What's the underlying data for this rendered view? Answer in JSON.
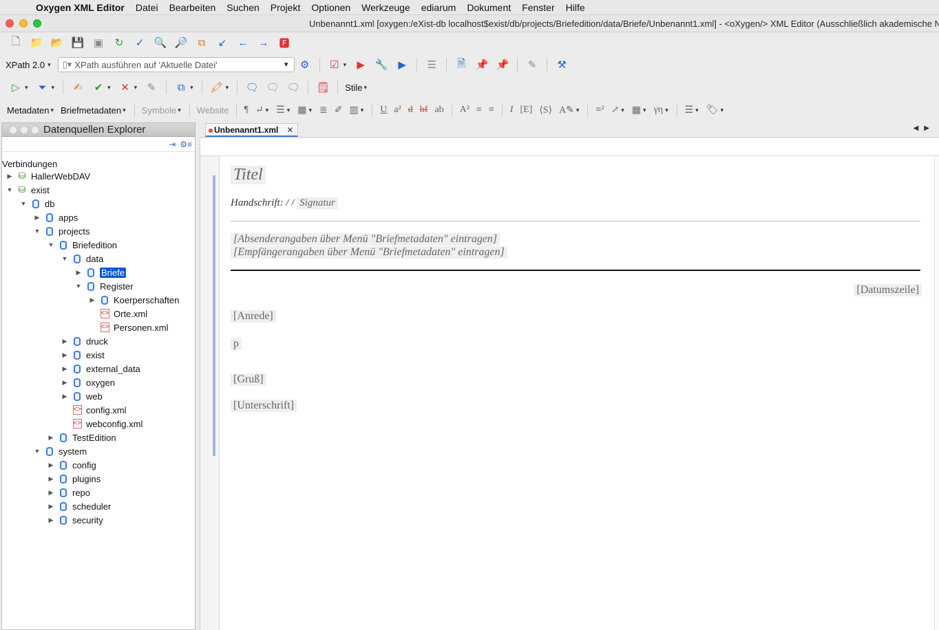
{
  "menubar": {
    "app_name": "Oxygen XML Editor",
    "items": [
      "Datei",
      "Bearbeiten",
      "Suchen",
      "Projekt",
      "Optionen",
      "Werkzeuge",
      "ediarum",
      "Dokument",
      "Fenster",
      "Hilfe"
    ]
  },
  "window": {
    "title": "Unbenannt1.xml [oxygen:/eXist-db localhost$exist/db/projects/Briefedition/data/Briefe/Unbenannt1.xml] - <oXygen/> XML Editor (Ausschließlich akademische Nutzung)"
  },
  "xpath": {
    "version_label": "XPath 2.0",
    "combo_text": "XPath ausführen auf  'Aktuelle Datei'"
  },
  "toolbar3": {
    "styles_label": "Stile"
  },
  "toolbar4": {
    "metadaten": "Metadaten",
    "briefmetadaten": "Briefmetadaten",
    "symbole": "Symbole",
    "website": "Website"
  },
  "explorer": {
    "title": "Datenquellen Explorer",
    "connections_label": "Verbindungen",
    "nodes": [
      {
        "label": "HallerWebDAV",
        "icon": "server-icon",
        "expanded": false
      },
      {
        "label": "exist",
        "icon": "server-icon",
        "expanded": true
      },
      {
        "label": "db",
        "icon": "database-icon",
        "expanded": true
      },
      {
        "label": "apps",
        "icon": "collection-icon",
        "expanded": false
      },
      {
        "label": "projects",
        "icon": "collection-icon",
        "expanded": true
      },
      {
        "label": "Briefedition",
        "icon": "collection-icon",
        "expanded": true
      },
      {
        "label": "data",
        "icon": "collection-icon",
        "expanded": true
      },
      {
        "label": "Briefe",
        "icon": "collection-icon",
        "expanded": false,
        "selected": true
      },
      {
        "label": "Register",
        "icon": "collection-icon",
        "expanded": true
      },
      {
        "label": "Koerperschaften",
        "icon": "collection-icon",
        "expanded": false
      },
      {
        "label": "Orte.xml",
        "icon": "xml-file-icon"
      },
      {
        "label": "Personen.xml",
        "icon": "xml-file-icon"
      },
      {
        "label": "druck",
        "icon": "collection-icon",
        "expanded": false
      },
      {
        "label": "exist",
        "icon": "collection-icon",
        "expanded": false
      },
      {
        "label": "external_data",
        "icon": "collection-icon",
        "expanded": false
      },
      {
        "label": "oxygen",
        "icon": "collection-icon",
        "expanded": false
      },
      {
        "label": "web",
        "icon": "collection-icon",
        "expanded": false
      },
      {
        "label": "config.xml",
        "icon": "xml-file-icon"
      },
      {
        "label": "webconfig.xml",
        "icon": "xml-file-icon"
      },
      {
        "label": "TestEdition",
        "icon": "collection-icon",
        "expanded": false
      },
      {
        "label": "system",
        "icon": "collection-icon",
        "expanded": true
      },
      {
        "label": "config",
        "icon": "collection-icon",
        "expanded": false
      },
      {
        "label": "plugins",
        "icon": "collection-icon",
        "expanded": false
      },
      {
        "label": "repo",
        "icon": "collection-icon",
        "expanded": false
      },
      {
        "label": "scheduler",
        "icon": "collection-icon",
        "expanded": false
      },
      {
        "label": "security",
        "icon": "collection-icon",
        "expanded": false
      }
    ]
  },
  "editor": {
    "tab_label": "Unbenannt1.xml",
    "doc": {
      "titel": "Titel",
      "handschrift_label": "Handschrift: / /",
      "signatur": "Signatur",
      "absender": "[Absenderangaben über Menü \"Briefmetadaten\" eintragen]",
      "empfaenger": "[Empfängerangaben über Menü \"Briefmetadaten\" eintragen]",
      "datumszeile": "[Datumszeile]",
      "anrede": "[Anrede]",
      "p": "p",
      "gruss": "[Gruß]",
      "unterschrift": "[Unterschrift]"
    }
  },
  "colors": {
    "selection": "#0a56d8",
    "accent": "#3a7bd5"
  }
}
